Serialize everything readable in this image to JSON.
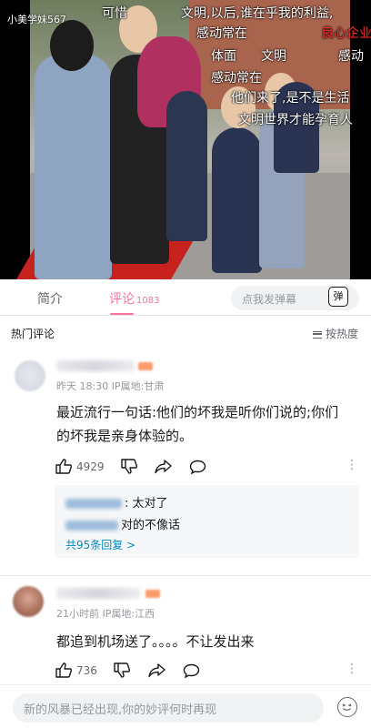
{
  "video": {
    "watermark": "小美学妹567",
    "danmaku": [
      {
        "text": "可惜",
        "color": "white"
      },
      {
        "text": "文明,以后,谁在乎我的利益,",
        "color": "white"
      },
      {
        "text": "感动常在",
        "color": "white"
      },
      {
        "text": "良心企业",
        "color": "red"
      },
      {
        "text": "体面",
        "color": "white"
      },
      {
        "text": "文明",
        "color": "white"
      },
      {
        "text": "感动",
        "color": "white"
      },
      {
        "text": "感动常在",
        "color": "white"
      },
      {
        "text": "他们来了,是不是生活",
        "color": "white"
      },
      {
        "text": "文明世界才能孕育人",
        "color": "white"
      }
    ]
  },
  "tabs": {
    "intro": "简介",
    "comments": "评论",
    "comments_count": "1083",
    "danmaku_placeholder": "点我发弹幕",
    "danmaku_button": "弹"
  },
  "comments_header": {
    "title": "热门评论",
    "sort_label": "按热度"
  },
  "comments": [
    {
      "meta": "昨天 18:30 IP属地:甘肃",
      "text_line1": "最近流行一句话:他们的坏我是听你们说的;你们",
      "text_line2": "的坏我是亲身体验的。",
      "likes": "4929",
      "replies": [
        {
          "text": ": 太对了"
        },
        {
          "text": "对的不像话"
        }
      ],
      "reply_more": "共95条回复 >"
    },
    {
      "meta": "21小时前 IP属地:江西",
      "text_line1": "都追到机场送了。。。。不让发出来",
      "likes": "736"
    }
  ],
  "bottom": {
    "placeholder": "新的风暴已经出现,你的妙评何时再现"
  },
  "colors": {
    "accent": "#fb7299",
    "link": "#008ac5"
  }
}
